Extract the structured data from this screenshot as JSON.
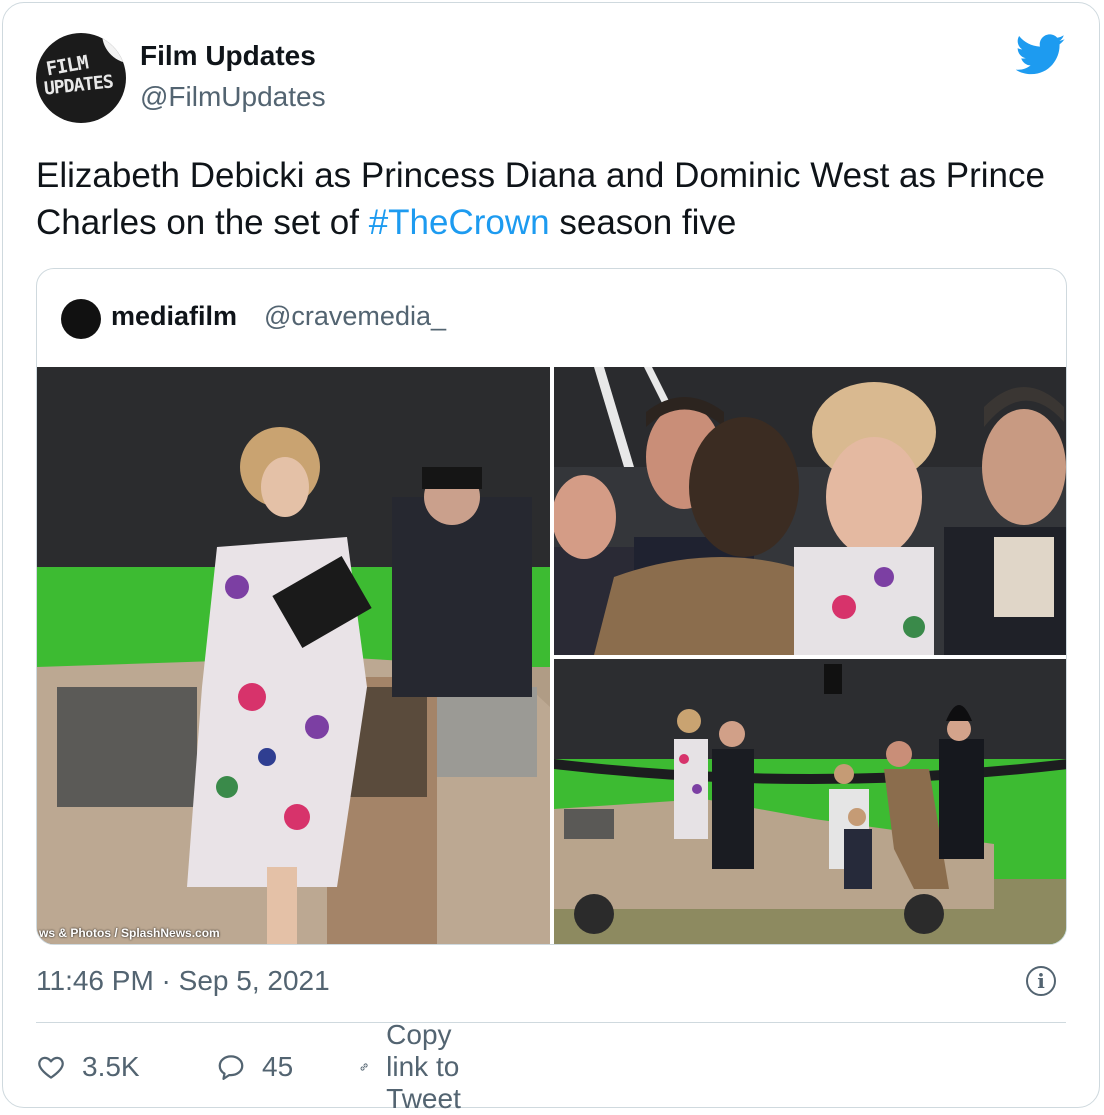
{
  "tweet": {
    "author_name": "Film Updates",
    "author_handle": "@FilmUpdates",
    "avatar_text_line1": "FILM",
    "avatar_text_line2": "UPDATES",
    "text_before_hashtag": "Elizabeth Debicki as Princess Diana and Dominic West as Prince Charles on the set of ",
    "hashtag": "#TheCrown",
    "text_after_hashtag": " season five",
    "timestamp": "11:46 PM · Sep 5, 2021",
    "info_icon": "info-icon",
    "brand_icon": "twitter-bird-icon",
    "brand_color": "#1d9bf0"
  },
  "quoted": {
    "author_name": "mediafilm",
    "author_handle": "@cravemedia_",
    "photo_credit": "ws & Photos / SplashNews.com"
  },
  "actions": {
    "likes": "3.5K",
    "replies": "45",
    "copy_link_label": "Copy link to Tweet"
  }
}
